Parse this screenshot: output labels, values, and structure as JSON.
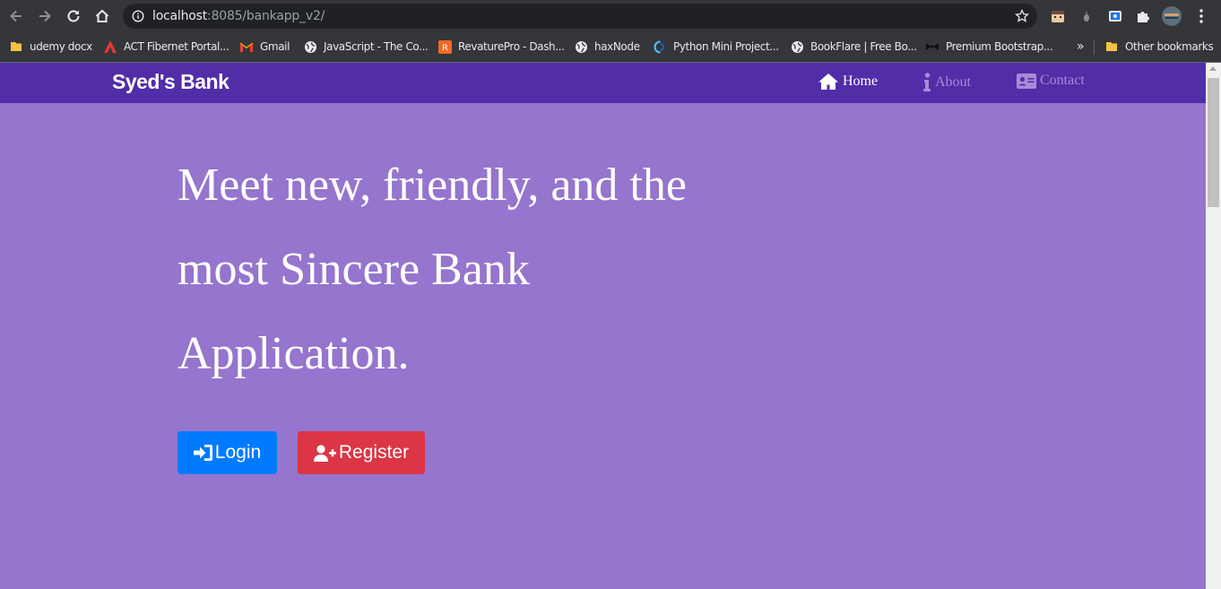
{
  "browser": {
    "url_host": "localhost",
    "url_rest": ":8085/bankapp_v2/",
    "bookmarks": [
      {
        "label": "udemy docx",
        "icon": "folder-icon"
      },
      {
        "label": "ACT Fibernet Portal...",
        "icon": "act-logo-icon"
      },
      {
        "label": "Gmail",
        "icon": "gmail-icon"
      },
      {
        "label": "JavaScript - The Co...",
        "icon": "globe-icon"
      },
      {
        "label": "RevaturePro - Dash...",
        "icon": "revature-icon"
      },
      {
        "label": "haxNode",
        "icon": "globe-icon"
      },
      {
        "label": "Python Mini Project...",
        "icon": "python-icon"
      },
      {
        "label": "BookFlare | Free Bo...",
        "icon": "globe-icon"
      },
      {
        "label": "Premium Bootstrap...",
        "icon": "bowtie-icon"
      }
    ],
    "overflow_label": "»",
    "other_bookmarks": "Other bookmarks"
  },
  "navbar": {
    "brand": "Syed's Bank",
    "links": [
      {
        "label": "Home",
        "icon": "home-icon",
        "active": true
      },
      {
        "label": "About",
        "icon": "info-icon",
        "active": false
      },
      {
        "label": "Contact",
        "icon": "id-card-icon",
        "active": false
      }
    ]
  },
  "hero": {
    "title": "Meet new, friendly, and the most Sincere Bank Application.",
    "login_label": "Login",
    "register_label": "Register"
  },
  "colors": {
    "page_bg": "#9575cd",
    "navbar_bg": "#512da8",
    "login_btn": "#007bff",
    "register_btn": "#dc3545"
  }
}
